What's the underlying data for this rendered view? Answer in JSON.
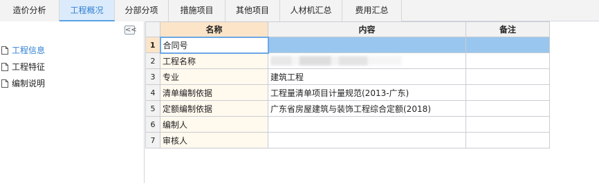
{
  "tabs": [
    {
      "label": "造价分析",
      "active": false
    },
    {
      "label": "工程概况",
      "active": true
    },
    {
      "label": "分部分项",
      "active": false
    },
    {
      "label": "措施项目",
      "active": false
    },
    {
      "label": "其他项目",
      "active": false
    },
    {
      "label": "人材机汇总",
      "active": false
    },
    {
      "label": "费用汇总",
      "active": false
    }
  ],
  "sidebar": {
    "collapse_label": "<<",
    "items": [
      {
        "label": "工程信息",
        "active": true
      },
      {
        "label": "工程特征",
        "active": false
      },
      {
        "label": "编制说明",
        "active": false
      }
    ]
  },
  "grid": {
    "columns": [
      "名称",
      "内容",
      "备注"
    ],
    "rows": [
      {
        "num": "1",
        "name": "合同号",
        "content": "",
        "note": ""
      },
      {
        "num": "2",
        "name": "工程名称",
        "content": "",
        "note": ""
      },
      {
        "num": "3",
        "name": "专业",
        "content": "建筑工程",
        "note": ""
      },
      {
        "num": "4",
        "name": "清单编制依据",
        "content": "工程量清单项目计量规范(2013-广东)",
        "note": ""
      },
      {
        "num": "5",
        "name": "定额编制依据",
        "content": "广东省房屋建筑与装饰工程综合定额(2018)",
        "note": ""
      },
      {
        "num": "6",
        "name": "编制人",
        "content": "",
        "note": ""
      },
      {
        "num": "7",
        "name": "审核人",
        "content": "",
        "note": ""
      }
    ]
  },
  "colors": {
    "tab_active_bg": "#dcebfb",
    "tab_active_text": "#2f7fd3",
    "header_name_bg": "#fbe4c8",
    "selection_bg": "#99c6ee"
  }
}
